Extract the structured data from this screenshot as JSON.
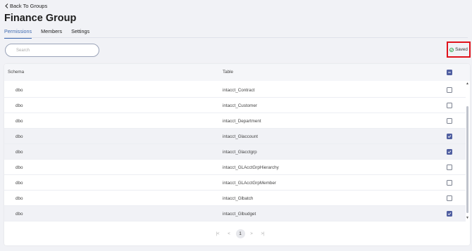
{
  "nav": {
    "back_label": "Back To Groups"
  },
  "page": {
    "title": "Finance Group"
  },
  "tabs": [
    {
      "label": "Permissions",
      "active": true
    },
    {
      "label": "Members",
      "active": false
    },
    {
      "label": "Settings",
      "active": false
    }
  ],
  "search": {
    "placeholder": "Search"
  },
  "status": {
    "saved_label": "Saved"
  },
  "table": {
    "headers": {
      "schema": "Schema",
      "table": "Table"
    },
    "select_all": "partial",
    "rows": [
      {
        "schema": "dbo",
        "table": "intacct_Contract",
        "checked": false
      },
      {
        "schema": "dbo",
        "table": "intacct_Customer",
        "checked": false
      },
      {
        "schema": "dbo",
        "table": "intacct_Department",
        "checked": false
      },
      {
        "schema": "dbo",
        "table": "intacct_Glaccount",
        "checked": true
      },
      {
        "schema": "dbo",
        "table": "intacct_Glacctgrp",
        "checked": true
      },
      {
        "schema": "dbo",
        "table": "intacct_GLAcctGrpHierarchy",
        "checked": false
      },
      {
        "schema": "dbo",
        "table": "intacct_GLAcctGrpMember",
        "checked": false
      },
      {
        "schema": "dbo",
        "table": "intacct_Glbatch",
        "checked": false
      },
      {
        "schema": "dbo",
        "table": "intacct_Glbudget",
        "checked": true
      }
    ]
  },
  "pagination": {
    "current_page": "1"
  },
  "colors": {
    "accent": "#3f6ab0",
    "checkbox_on": "#4f5ea0",
    "highlight_border": "#e0121b"
  }
}
